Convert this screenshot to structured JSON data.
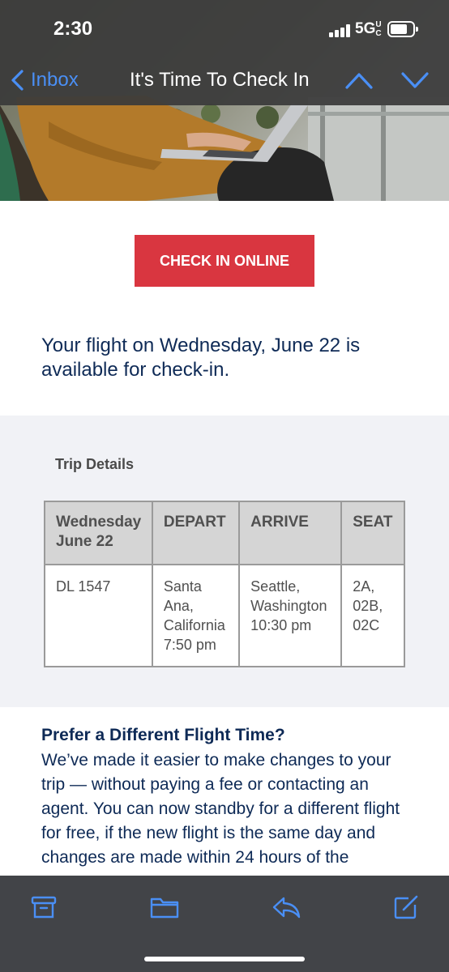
{
  "status": {
    "time": "2:30",
    "network": "5G UC"
  },
  "nav": {
    "back_label": "Inbox",
    "title": "It's Time To Check In",
    "icons": [
      "chevron-left-icon",
      "chevron-up-icon",
      "chevron-down-icon"
    ]
  },
  "email": {
    "cta_label": "CHECK IN ONLINE",
    "intro": "Your flight on Wednesday, June 22 is available for check-in.",
    "trip_details_label": "Trip Details",
    "trip_table": {
      "headers": [
        "Wednesday\nJune 22",
        "DEPART",
        "ARRIVE",
        "SEAT"
      ],
      "row": [
        "DL 1547",
        "Santa\nAna,\nCalifornia\n7:50 pm",
        "Seattle,\nWashington\n10:30 pm",
        "2A,\n02B,\n02C"
      ]
    },
    "prefer_heading": "Prefer a Different Flight Time?",
    "prefer_body": "We’ve made it easier to make changes to your trip — without paying a fee or contacting an agent. You can now standby for a different flight for free, if the new flight is the same day and changes are made within 24 hours of the"
  },
  "toolbar": {
    "icons": [
      "archive-icon",
      "folder-icon",
      "reply-icon",
      "compose-icon"
    ]
  },
  "colors": {
    "accent_blue": "#4a8ff5",
    "cta_red": "#d93640",
    "text_navy": "#0e2a56",
    "section_bg": "#f1f2f6",
    "table_header_bg": "#d5d5d5"
  }
}
